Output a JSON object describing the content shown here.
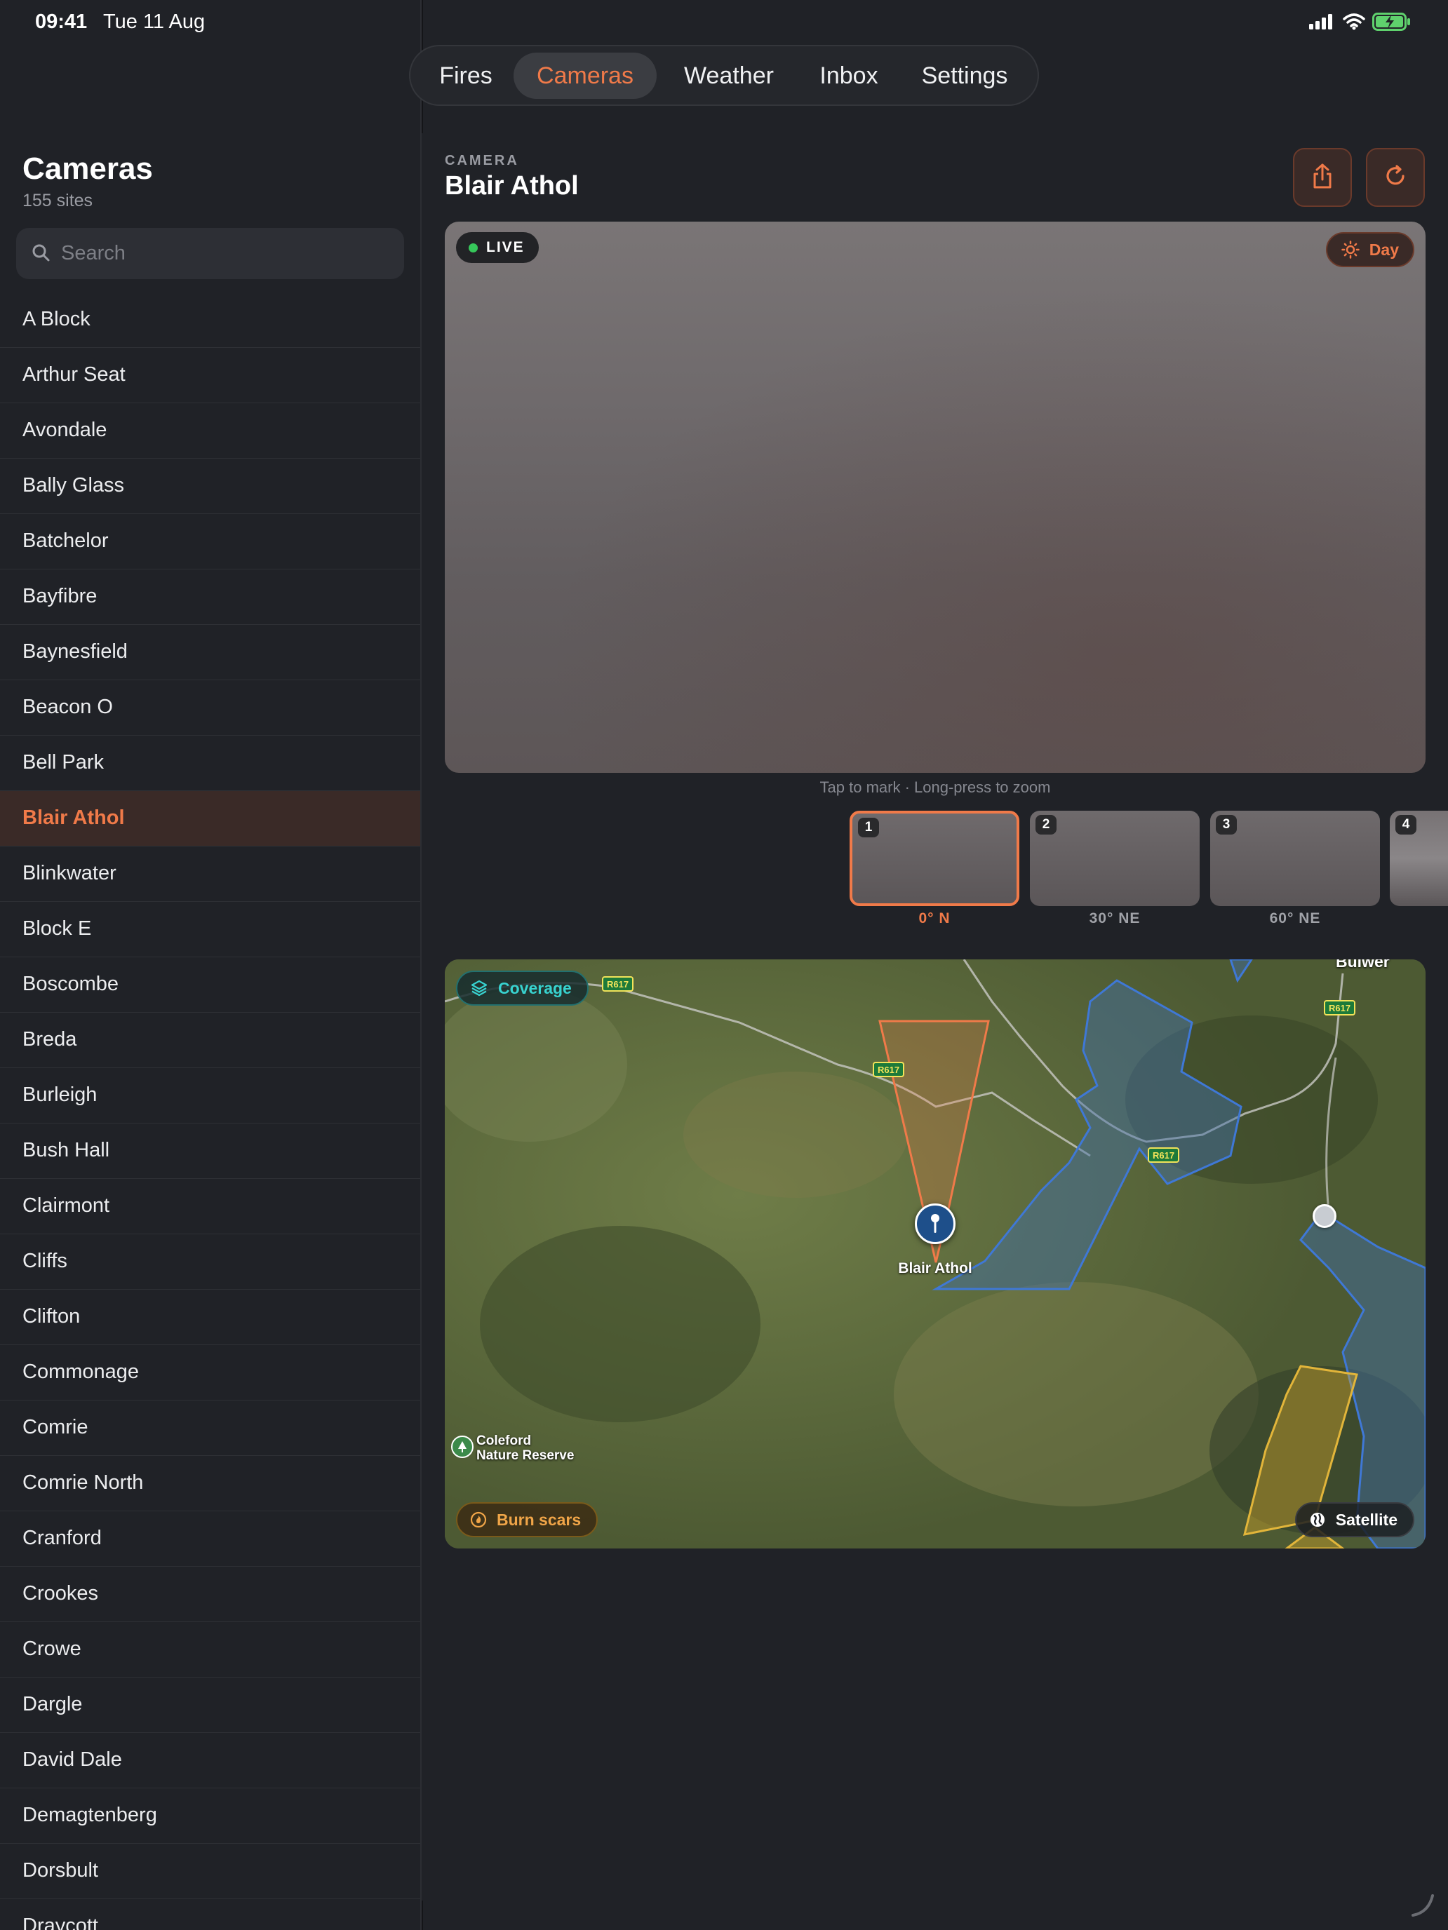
{
  "status": {
    "time": "09:41",
    "date": "Tue 11 Aug"
  },
  "nav": {
    "tabs": [
      "Fires",
      "Cameras",
      "Weather",
      "Inbox",
      "Settings"
    ],
    "active": "Cameras"
  },
  "sidebar": {
    "title": "Cameras",
    "subtitle": "155 sites",
    "search_placeholder": "Search",
    "selected": "Blair Athol",
    "items": [
      "A Block",
      "Arthur Seat",
      "Avondale",
      "Bally Glass",
      "Batchelor",
      "Bayfibre",
      "Baynesfield",
      "Beacon O",
      "Bell Park",
      "Blair Athol",
      "Blinkwater",
      "Block E",
      "Boscombe",
      "Breda",
      "Burleigh",
      "Bush Hall",
      "Clairmont",
      "Cliffs",
      "Clifton",
      "Commonage",
      "Comrie",
      "Comrie North",
      "Cranford",
      "Crookes",
      "Crowe",
      "Dargle",
      "David Dale",
      "Demagtenberg",
      "Dorsbult",
      "Draycott"
    ]
  },
  "camera": {
    "kicker": "CAMERA",
    "name": "Blair Athol",
    "live_label": "LIVE",
    "mode_label": "Day",
    "hint": "Tap to mark · Long-press to zoom",
    "views": [
      {
        "num": "1",
        "label": "0° N",
        "selected": true
      },
      {
        "num": "2",
        "label": "30° NE",
        "selected": false
      },
      {
        "num": "3",
        "label": "60° NE",
        "selected": false
      },
      {
        "num": "4",
        "label": "",
        "selected": false
      }
    ]
  },
  "map": {
    "coverage_label": "Coverage",
    "burn_label": "Burn scars",
    "satellite_label": "Satellite",
    "pin_label": "Blair Athol",
    "reserve_label_1": "Coleford",
    "reserve_label_2": "Nature Reserve",
    "road_label": "R617",
    "place_partial": "Bulwer"
  },
  "colors": {
    "accent": "#f07a49",
    "live": "#36c75a",
    "coverage": "#38d3d0",
    "burn": "#f0a548"
  }
}
